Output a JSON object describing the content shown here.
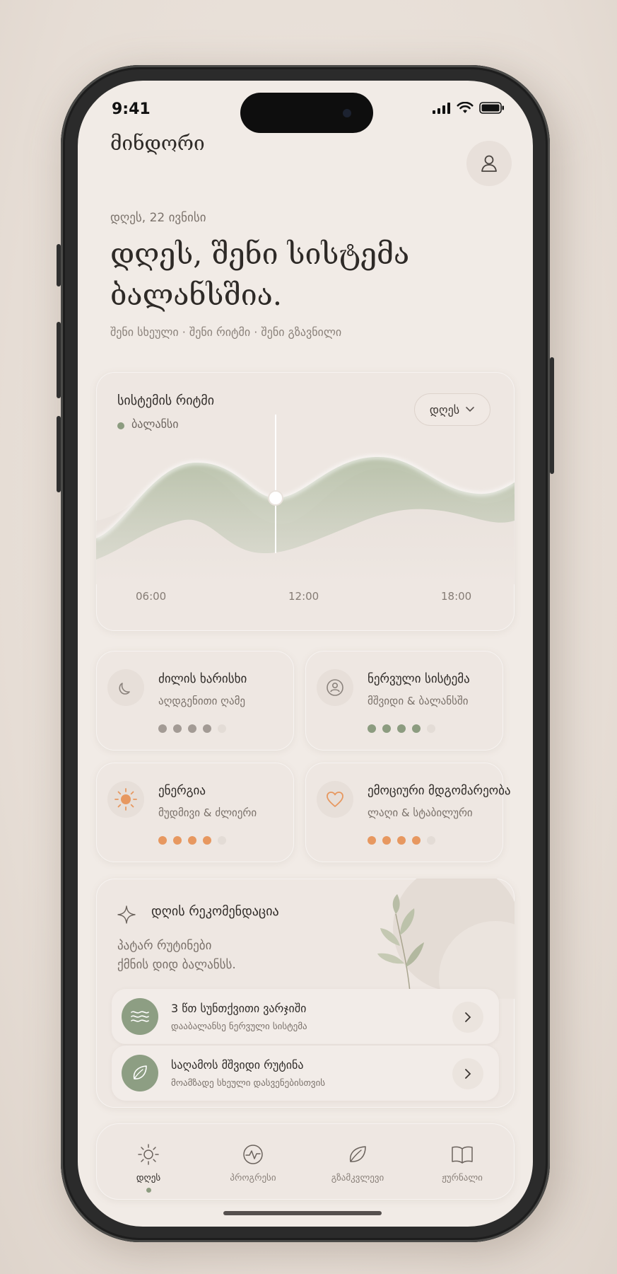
{
  "status_bar": {
    "time": "9:41"
  },
  "header": {
    "app_title": "მინდორი",
    "date": "დღეს, 22 ივნისი",
    "headline_line1": "დღეს, შენი სისტემა",
    "headline_line2": "ბალანსშია.",
    "subline": "შენი სხეული · შენი რიტმი · შენი გზავნილი"
  },
  "rhythm": {
    "title": "სისტემის რიტმი",
    "legend": "ბალანსი",
    "period": "დღეს",
    "colors": {
      "wave": "#a9b79a",
      "legend": "#8c9c80"
    }
  },
  "chart_data": {
    "type": "area",
    "title": "სისტემის რიტმი",
    "x_ticks": [
      "06:00",
      "12:00",
      "18:00"
    ],
    "series": [
      {
        "name": "ბალანსი"
      }
    ],
    "marker_at": "12:00"
  },
  "metrics": [
    {
      "title": "ძილის ხარისხი",
      "subtitle": "აღდგენითი ღამე",
      "icon": "moon-icon",
      "filled": 4,
      "total": 5,
      "color": "#a39b95"
    },
    {
      "title": "ნერვული სისტემა",
      "subtitle": "მშვიდი & ბალანსში",
      "icon": "person-icon",
      "filled": 4,
      "total": 5,
      "color": "#8c9c80"
    },
    {
      "title": "ენერგია",
      "subtitle": "მუდმივი & ძლიერი",
      "icon": "sun-icon",
      "filled": 4,
      "total": 5,
      "color": "#e79860"
    },
    {
      "title": "ემოციური მდგომარეობა",
      "subtitle": "ლაღი & სტაბილური",
      "icon": "heart-icon",
      "filled": 4,
      "total": 5,
      "color": "#e79860"
    }
  ],
  "recommendation": {
    "title": "დღის რეკომენდაცია",
    "text_line1": "პატარ რუტინები",
    "text_line2": "ქმნის დიდ ბალანსს.",
    "items": [
      {
        "title": "3 წთ სუნთქვითი ვარჯიში",
        "subtitle": "დააბალანსე ნერვული სისტემა",
        "icon": "wave-icon"
      },
      {
        "title": "საღამოს მშვიდი რუტინა",
        "subtitle": "მოამზადე სხეული დასვენებისთვის",
        "icon": "leaf-icon"
      }
    ]
  },
  "tabs": [
    {
      "label": "დღეს",
      "icon": "sun-icon",
      "active": true
    },
    {
      "label": "პროგრესი",
      "icon": "pulse-icon",
      "active": false
    },
    {
      "label": "გზამკვლევი",
      "icon": "leaf-icon",
      "active": false
    },
    {
      "label": "ჟურნალი",
      "icon": "book-icon",
      "active": false
    }
  ]
}
